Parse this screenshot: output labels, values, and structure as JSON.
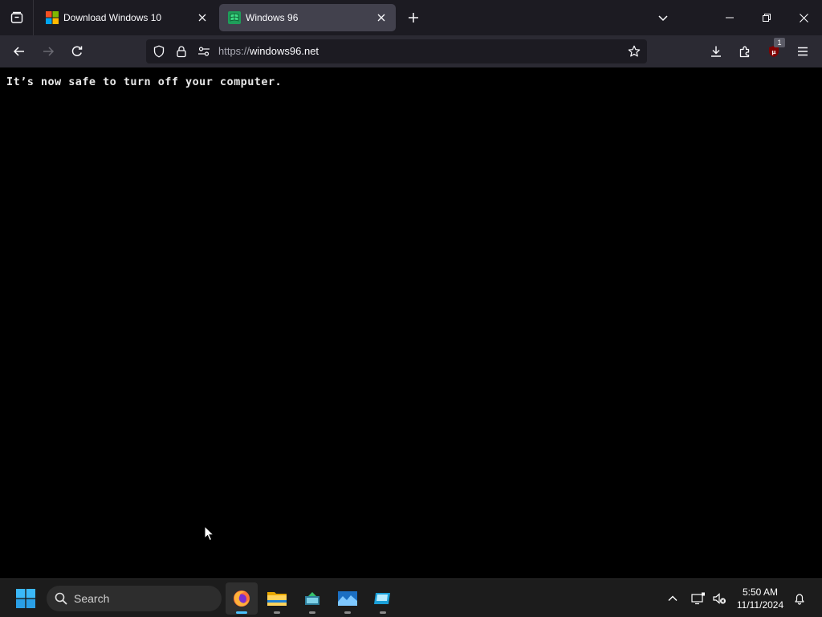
{
  "browser": {
    "tabs": [
      {
        "title": "Download Windows 10",
        "favicon": "windows-logo-icon",
        "active": false
      },
      {
        "title": "Windows 96",
        "favicon": "windows96-flag-icon",
        "active": true
      }
    ],
    "address": {
      "scheme": "https://",
      "host": "windows96.net"
    },
    "extension_badge": "1"
  },
  "page": {
    "message": "It’s now safe to turn off your computer."
  },
  "taskbar": {
    "search_label": "Search",
    "apps": [
      "firefox-icon",
      "file-explorer-icon",
      "app-icon",
      "app-icon",
      "app-icon"
    ],
    "active_app": "firefox-icon",
    "clock": {
      "time": "5:50 AM",
      "date": "11/11/2024"
    }
  },
  "colors": {
    "tabstrip_bg": "#1c1b22",
    "navbar_bg": "#2b2a33",
    "active_tab_bg": "#42414d",
    "page_bg": "#000000",
    "taskbar_bg": "#1c1c1c",
    "accent": "#4cc2ff"
  }
}
